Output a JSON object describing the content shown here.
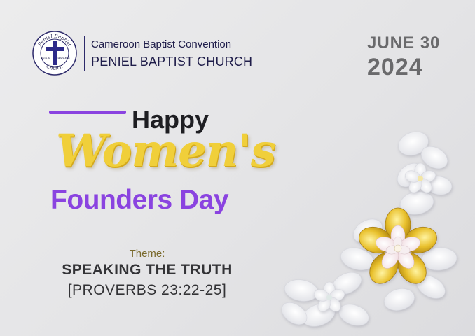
{
  "header": {
    "logo": {
      "ring_top_text": "Peniel Baptist",
      "ring_bottom_text": "Church",
      "left_text": "Mile 9",
      "right_text": "Bambui",
      "cross_color": "#2d2a8a"
    },
    "org_line1": "Cameroon Baptist Convention",
    "org_line2": "PENIEL BAPTIST CHURCH",
    "date_line1": "JUNE 30",
    "date_line2": "2024"
  },
  "title": {
    "line1": "Happy",
    "line2": "Women's",
    "line3": "Founders Day"
  },
  "theme": {
    "label": "Theme:",
    "title": "SPEAKING THE TRUTH",
    "verse": "[PROVERBS 23:22-25]"
  },
  "colors": {
    "accent_purple": "#8a43e0",
    "gold": "#f0cf3a",
    "navy": "#1f1d4a",
    "date_gray": "#6a6a6c"
  },
  "decor": {
    "flower_icon": "flower-cluster-icon"
  }
}
